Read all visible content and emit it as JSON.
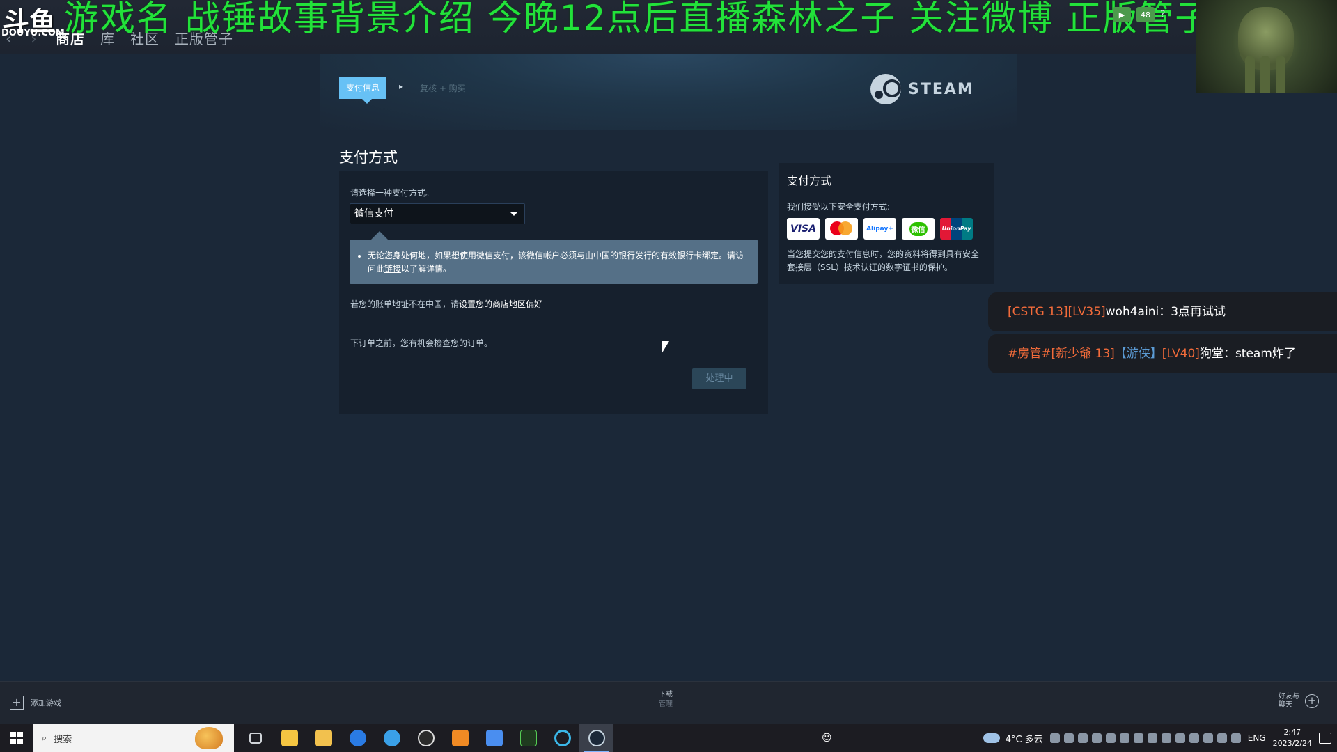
{
  "overlay": {
    "douyu_logo": "斗鱼",
    "douyu_domain": "DOUYU.COM",
    "banner": "游戏名 战锤故事背景介绍 今晚12点后直播森林之子   关注微博 正版管子",
    "top_icon_1": "▶",
    "top_icon_2": "48",
    "help": "?"
  },
  "steam_nav": {
    "back_icon": "‹",
    "forward_icon": "›",
    "tabs": [
      {
        "label": "商店"
      },
      {
        "label": "库"
      },
      {
        "label": "社区"
      },
      {
        "label": "正版管子"
      }
    ]
  },
  "checkout": {
    "step_active": "支付信息",
    "step_separator": "▸",
    "step_next": "复核 + 购买",
    "steam_wordmark": "STEAM"
  },
  "payment": {
    "title": "支付方式",
    "select_label": "请选择一种支付方式。",
    "selected_method": "微信支付",
    "notice_before": "无论您身处何地，如果想使用微信支付，该微信帐户必须与由中国的银行发行的有效银行卡绑定。请访问此",
    "notice_link": "链接",
    "notice_after": "以了解详情。",
    "region_text": "若您的账单地址不在中国，请",
    "region_link": "设置您的商店地区偏好",
    "order_text": "下订单之前，您有机会检查您的订单。",
    "processing_button": "处理中"
  },
  "side": {
    "title": "支付方式",
    "accept_text": "我们接受以下安全支付方式:",
    "cards": [
      "VISA",
      "mastercard",
      "Alipay+",
      "微信",
      "UnionPay"
    ],
    "ssl_text": "当您提交您的支付信息时，您的资料将得到具有安全套接层（SSL）技术认证的数字证书的保护。"
  },
  "chat": [
    {
      "tag": "[CSTG 13][LV35]",
      "user": "woh4aini",
      "message": "3点再试试"
    },
    {
      "tag": "#房管#[新少爺 13]",
      "tag2": "【游侠】",
      "tag3": "[LV40]",
      "user": "狗堂",
      "message": "steam炸了"
    }
  ],
  "bottom_bar": {
    "add_game": "添加游戏",
    "downloads": "下载",
    "downloads_sub": "管理",
    "friends_line1": "好友与",
    "friends_line2": "聊天"
  },
  "taskbar": {
    "search_placeholder": "搜索",
    "weather": "4°C 多云",
    "lang": "ENG",
    "time": "2:47",
    "date": "2023/2/24"
  },
  "colors": {
    "steam_bg": "#1b2838",
    "accent_blue": "#67c1f5",
    "banner_green": "#22e23a",
    "chat_tag_orange": "#f26b3a"
  }
}
